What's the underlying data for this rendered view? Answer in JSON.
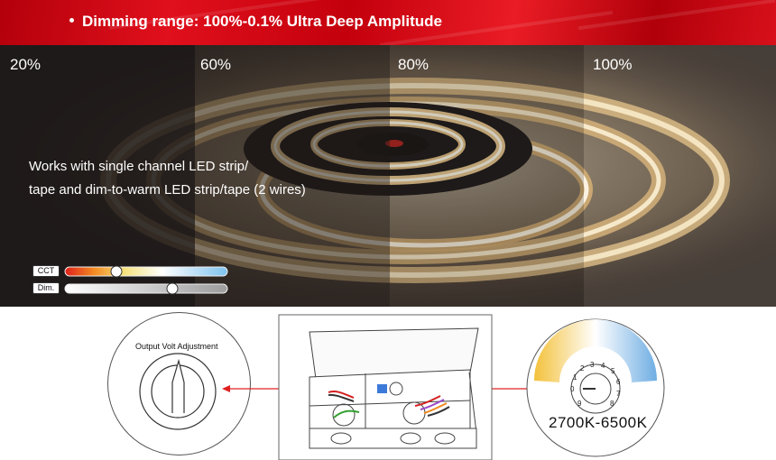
{
  "banner": {
    "text": "Dimming range: 100%-0.1% Ultra Deep Amplitude"
  },
  "brightness_levels": [
    "20%",
    "60%",
    "80%",
    "100%"
  ],
  "description": {
    "line1": "Works with single channel LED strip/",
    "line2": "tape and dim-to-warm LED strip/tape (2 wires)"
  },
  "sliders": {
    "cct_label": "CCT",
    "dim_label": "Dim."
  },
  "adjustment": {
    "label": "Output Volt Adjustment"
  },
  "cct_dial": {
    "range": "2700K-6500K",
    "digits": [
      "0",
      "1",
      "2",
      "3",
      "4",
      "5",
      "6",
      "7",
      "8",
      "9"
    ]
  },
  "colors": {
    "banner_red": "#d8101b",
    "warm": "#f3c54a",
    "cool": "#6fb0e6",
    "arrow": "#e02020"
  }
}
